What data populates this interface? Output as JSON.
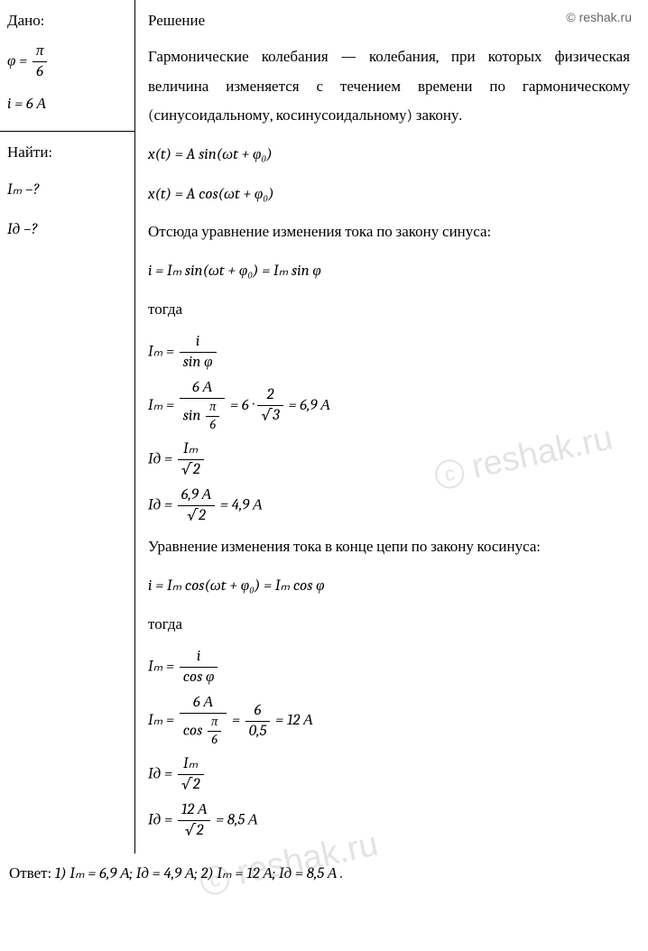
{
  "copyright": "© reshak.ru",
  "watermarks": [
    "reshak.ru",
    "reshak.ru"
  ],
  "given": {
    "label": "Дано:",
    "phi_eq": "φ =",
    "phi_num": "π",
    "phi_den": "6",
    "i_eq": "i = 6 А"
  },
  "find": {
    "label": "Найти:",
    "q1": "Iₘ –?",
    "q2": "Iд –?"
  },
  "solution": {
    "label": "Решение",
    "intro": "Гармонические колебания — колебания, при которых физическая величина изменяется с течением времени по гармоническому (синусоидальному, косинусоидальному) закону.",
    "xt_sin": "x(t) = A sin(ωt + φ₀)",
    "xt_cos": "x(t) = A cos(ωt + φ₀)",
    "sin_law": "Отсюда уравнение изменения тока по закону синуса:",
    "i_sin": "i = Iₘ sin(ωt + φ₀) = Iₘ sin φ",
    "then": "тогда",
    "Im_frac_label": "Iₘ =",
    "Im_sin_num": "i",
    "Im_sin_den": "sin φ",
    "Im_calc_num": "6 А",
    "Im_calc_den_prefix": "sin",
    "Im_calc_den_num": "π",
    "Im_calc_den_den": "6",
    "Im_calc_mid": "= 6 ·",
    "Im_calc_mid_num": "2",
    "Im_calc_mid_den": "√3",
    "Im_sin_result": "= 6,9 А",
    "Id_label": "Iд =",
    "Id_num": "Iₘ",
    "Id_den": "√2",
    "Id_calc_num": "6,9 А",
    "Id_calc_den": "√2",
    "Id_sin_result": "= 4,9 А",
    "cos_law": "Уравнение изменения тока в конце цепи по закону косинуса:",
    "i_cos": "i = Iₘ cos(ωt + φ₀) = Iₘ cos φ",
    "Im_cos_den": "cos φ",
    "Im_cos_calc_den_prefix": "cos",
    "Im_cos_mid_num": "6",
    "Im_cos_mid_den": "0,5",
    "Im_cos_result": "= 12 А",
    "Id_cos_calc_num": "12 А",
    "Id_cos_result": "= 8,5 А"
  },
  "answer": {
    "label": "Ответ: ",
    "text": "1) Iₘ = 6,9 А;  Iд = 4,9 А; 2) Iₘ = 12 А;  Iд = 8,5 А ."
  }
}
